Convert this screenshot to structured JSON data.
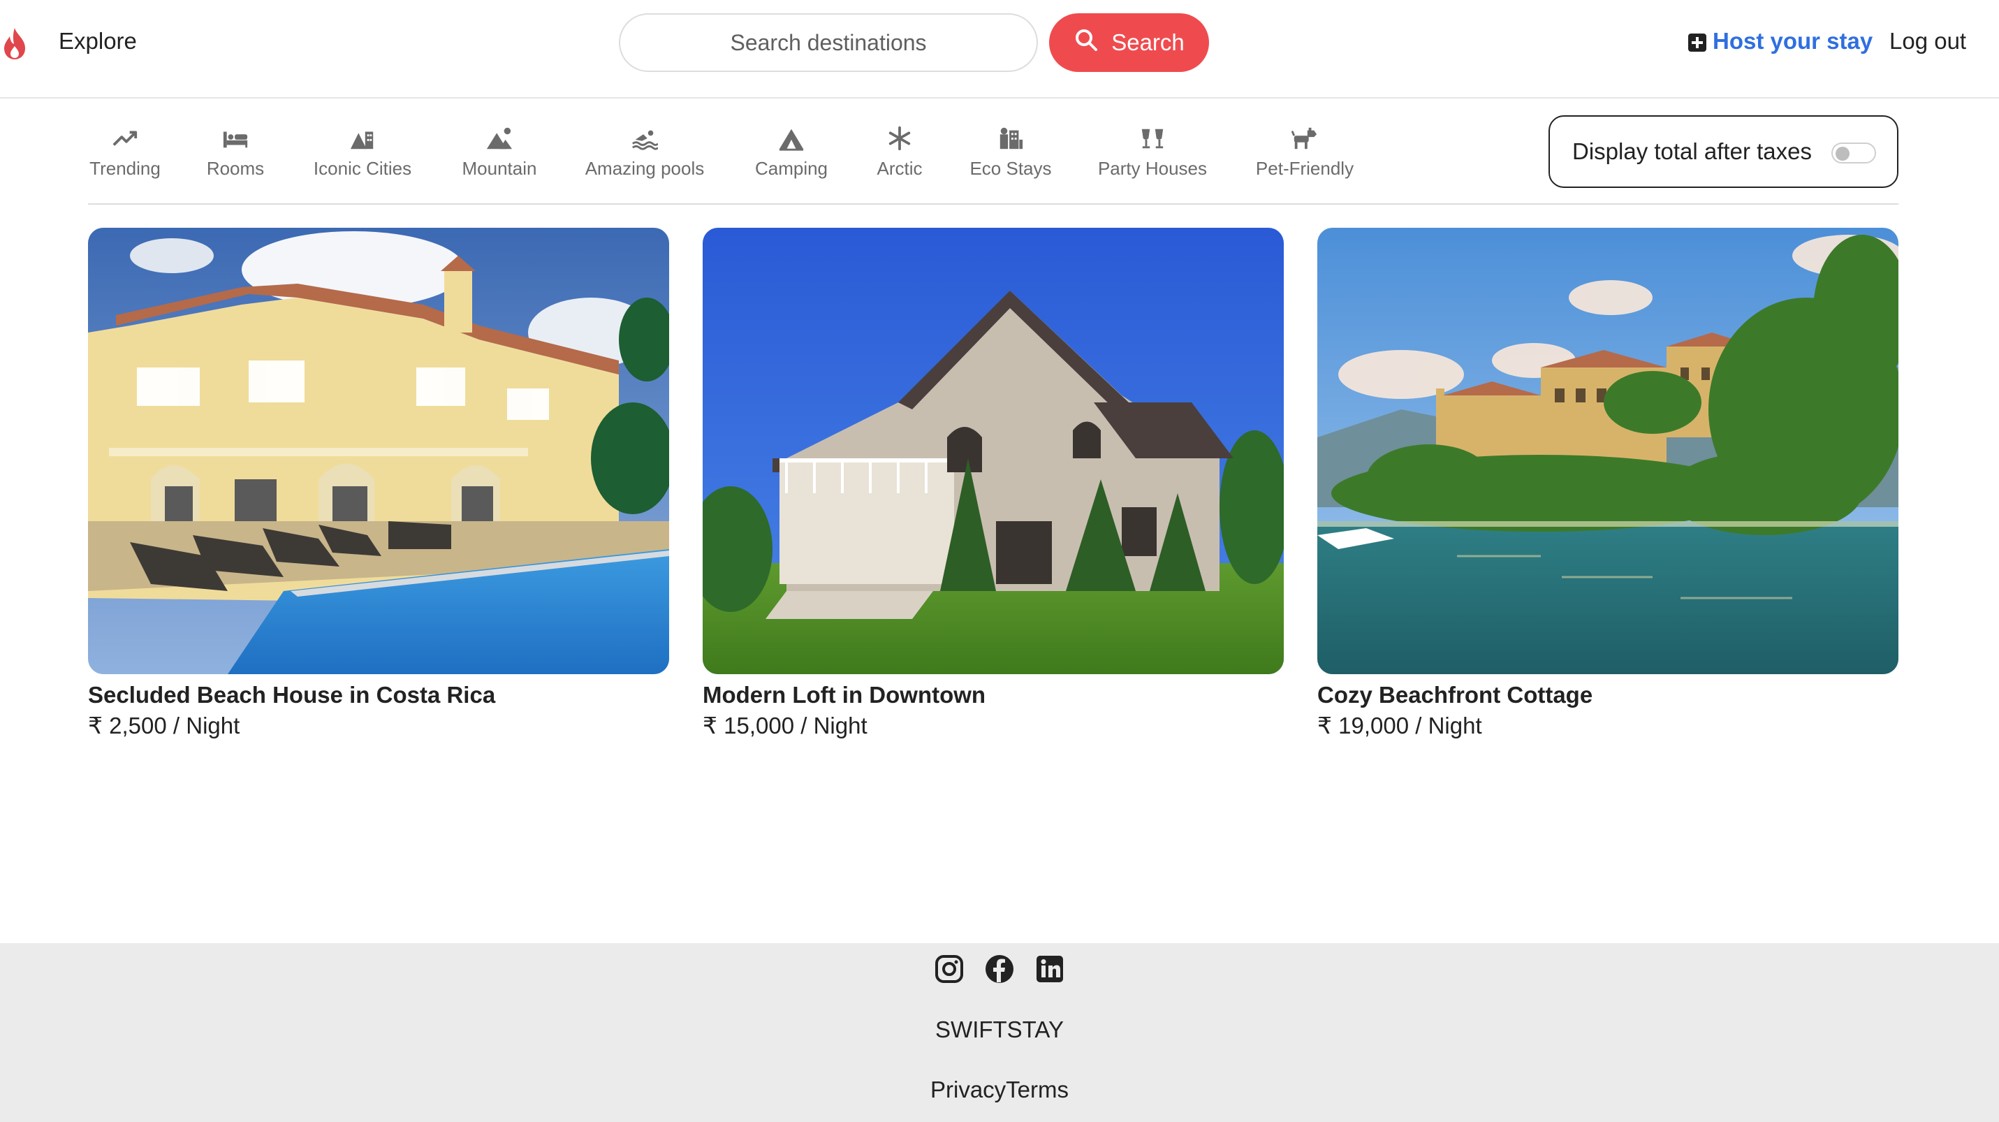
{
  "navbar": {
    "logo_icon": "flame-logo-icon",
    "explore_label": "Explore",
    "search_placeholder": "Search destinations",
    "search_button_label": "Search",
    "search_icon": "search-icon",
    "host_label": "Host your stay",
    "host_icon": "plus-square-icon",
    "logout_label": "Log out",
    "accent_color": "#ef4b4f",
    "link_color": "#2f6fe0"
  },
  "filters": [
    {
      "label": "Trending",
      "icon": "trending-up-icon"
    },
    {
      "label": "Rooms",
      "icon": "bed-icon"
    },
    {
      "label": "Iconic Cities",
      "icon": "mountain-city-icon"
    },
    {
      "label": "Mountain",
      "icon": "mountain-sun-icon"
    },
    {
      "label": "Amazing pools",
      "icon": "person-swimming-icon"
    },
    {
      "label": "Camping",
      "icon": "campground-icon"
    },
    {
      "label": "Arctic",
      "icon": "snowflake-icon"
    },
    {
      "label": "Eco Stays",
      "icon": "eco-building-icon"
    },
    {
      "label": "Party Houses",
      "icon": "party-glasses-icon"
    },
    {
      "label": "Pet-Friendly",
      "icon": "dog-icon"
    }
  ],
  "tax_toggle": {
    "label": "Display total after taxes",
    "checked": false
  },
  "listings": [
    {
      "title": "Secluded Beach House in Costa Rica",
      "price": "₹ 2,500 / Night",
      "image": "villa-with-pool-photo"
    },
    {
      "title": "Modern Loft in Downtown",
      "price": "₹ 15,000 / Night",
      "image": "house-blue-sky-photo"
    },
    {
      "title": "Cozy Beachfront Cottage",
      "price": "₹ 19,000 / Night",
      "image": "lakeside-villa-photo"
    }
  ],
  "footer": {
    "social": [
      {
        "icon": "instagram-icon"
      },
      {
        "icon": "facebook-icon"
      },
      {
        "icon": "linkedin-icon"
      }
    ],
    "brand": "SWIFTSTAY",
    "privacy_label": "Privacy",
    "terms_label": "Terms",
    "background": "#ebebeb"
  }
}
